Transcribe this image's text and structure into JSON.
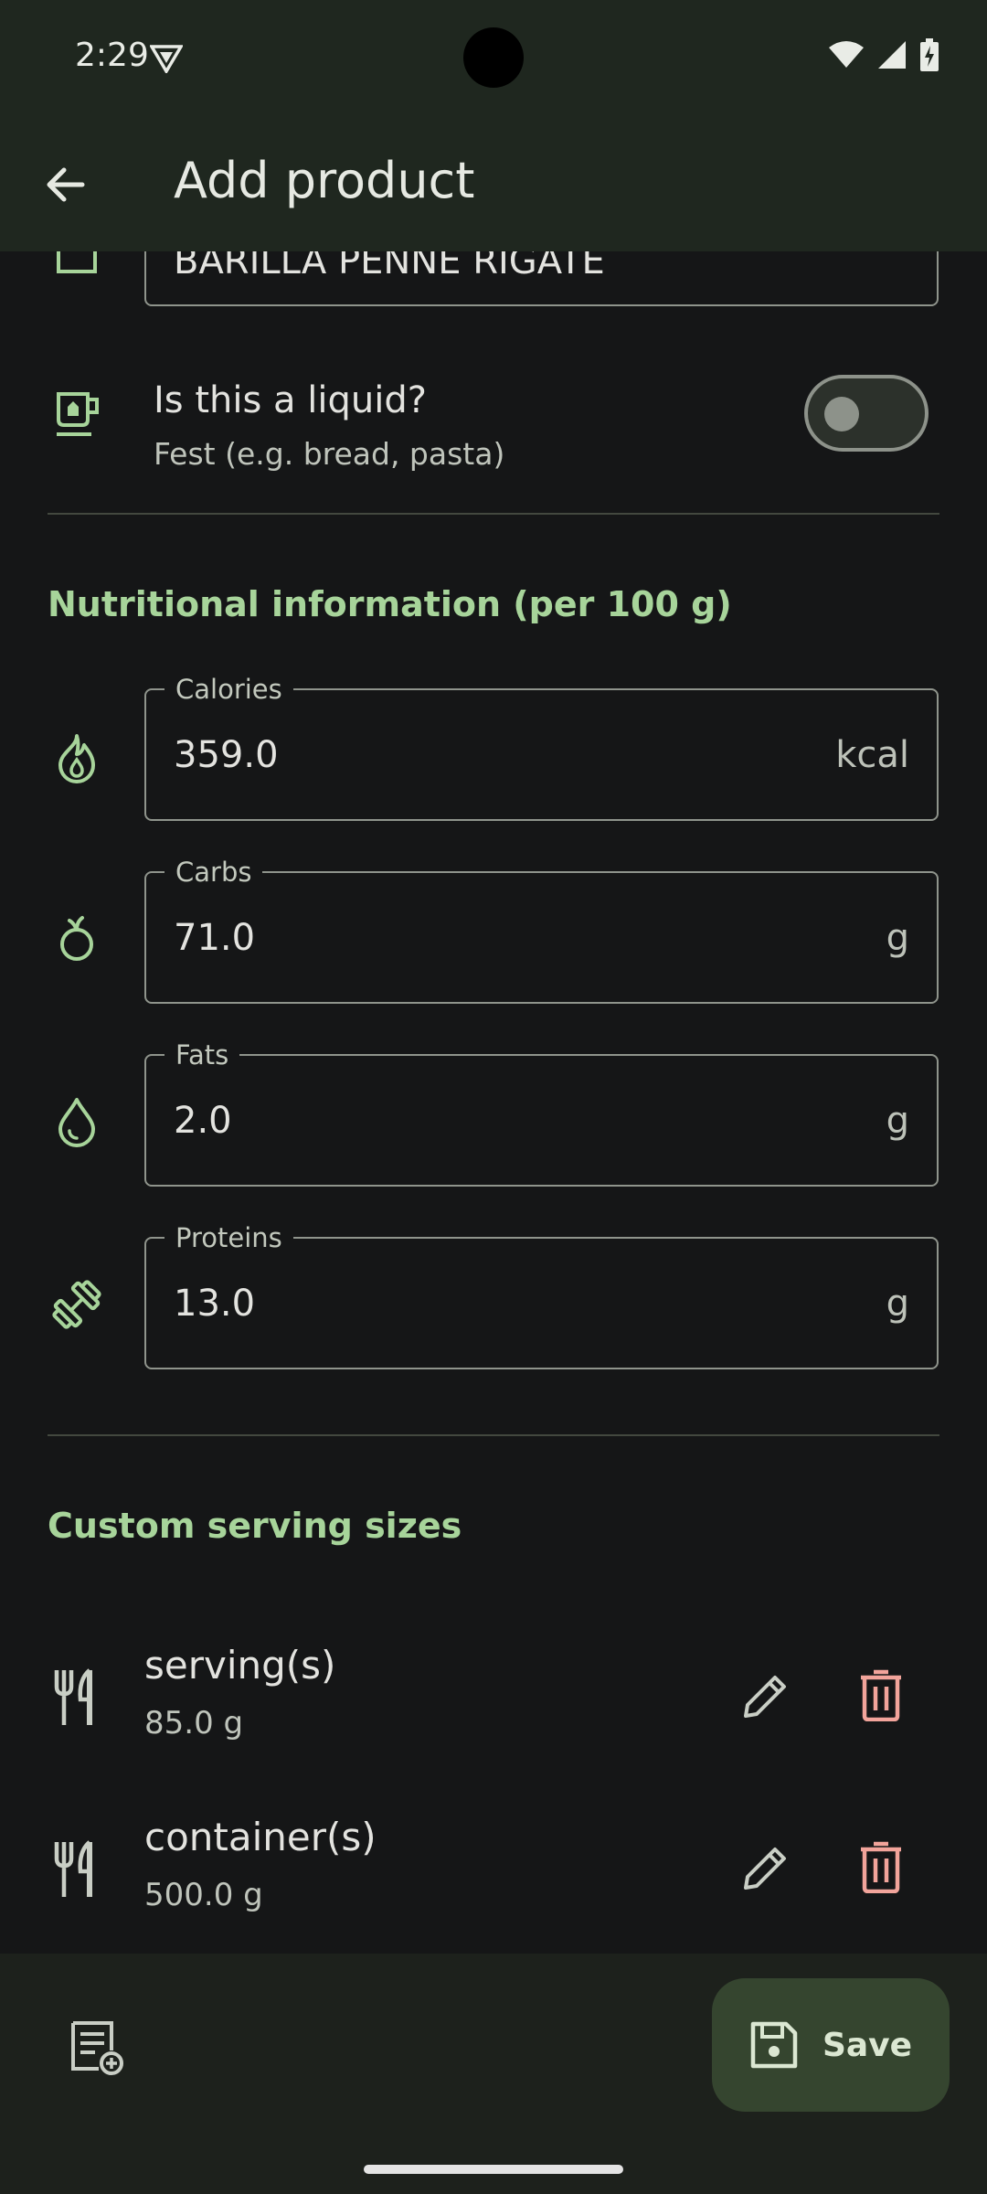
{
  "status_bar": {
    "time": "2:29"
  },
  "app_bar": {
    "title": "Add product"
  },
  "partial_field": {
    "value": "BARILLA PENNE RIGATE"
  },
  "liquid": {
    "title": "Is this a liquid?",
    "subtitle": "Fest (e.g. bread, pasta)",
    "checked": false
  },
  "nutrition": {
    "section_title": "Nutritional information (per 100 g)",
    "fields": [
      {
        "label": "Calories",
        "value": "359.0",
        "unit": "kcal",
        "icon": "flame-icon"
      },
      {
        "label": "Carbs",
        "value": "71.0",
        "unit": "g",
        "icon": "apple-icon"
      },
      {
        "label": "Fats",
        "value": "2.0",
        "unit": "g",
        "icon": "drop-icon"
      },
      {
        "label": "Proteins",
        "value": "13.0",
        "unit": "g",
        "icon": "dumbbell-icon"
      }
    ]
  },
  "servings": {
    "section_title": "Custom serving sizes",
    "items": [
      {
        "name": "serving(s)",
        "amount": "85.0 g"
      },
      {
        "name": "container(s)",
        "amount": "500.0 g"
      }
    ]
  },
  "bottom": {
    "save_label": "Save"
  },
  "colors": {
    "accent": "#a7d49a",
    "delete": "#f2a49b",
    "bar": "#1f271f",
    "background": "#151617"
  }
}
